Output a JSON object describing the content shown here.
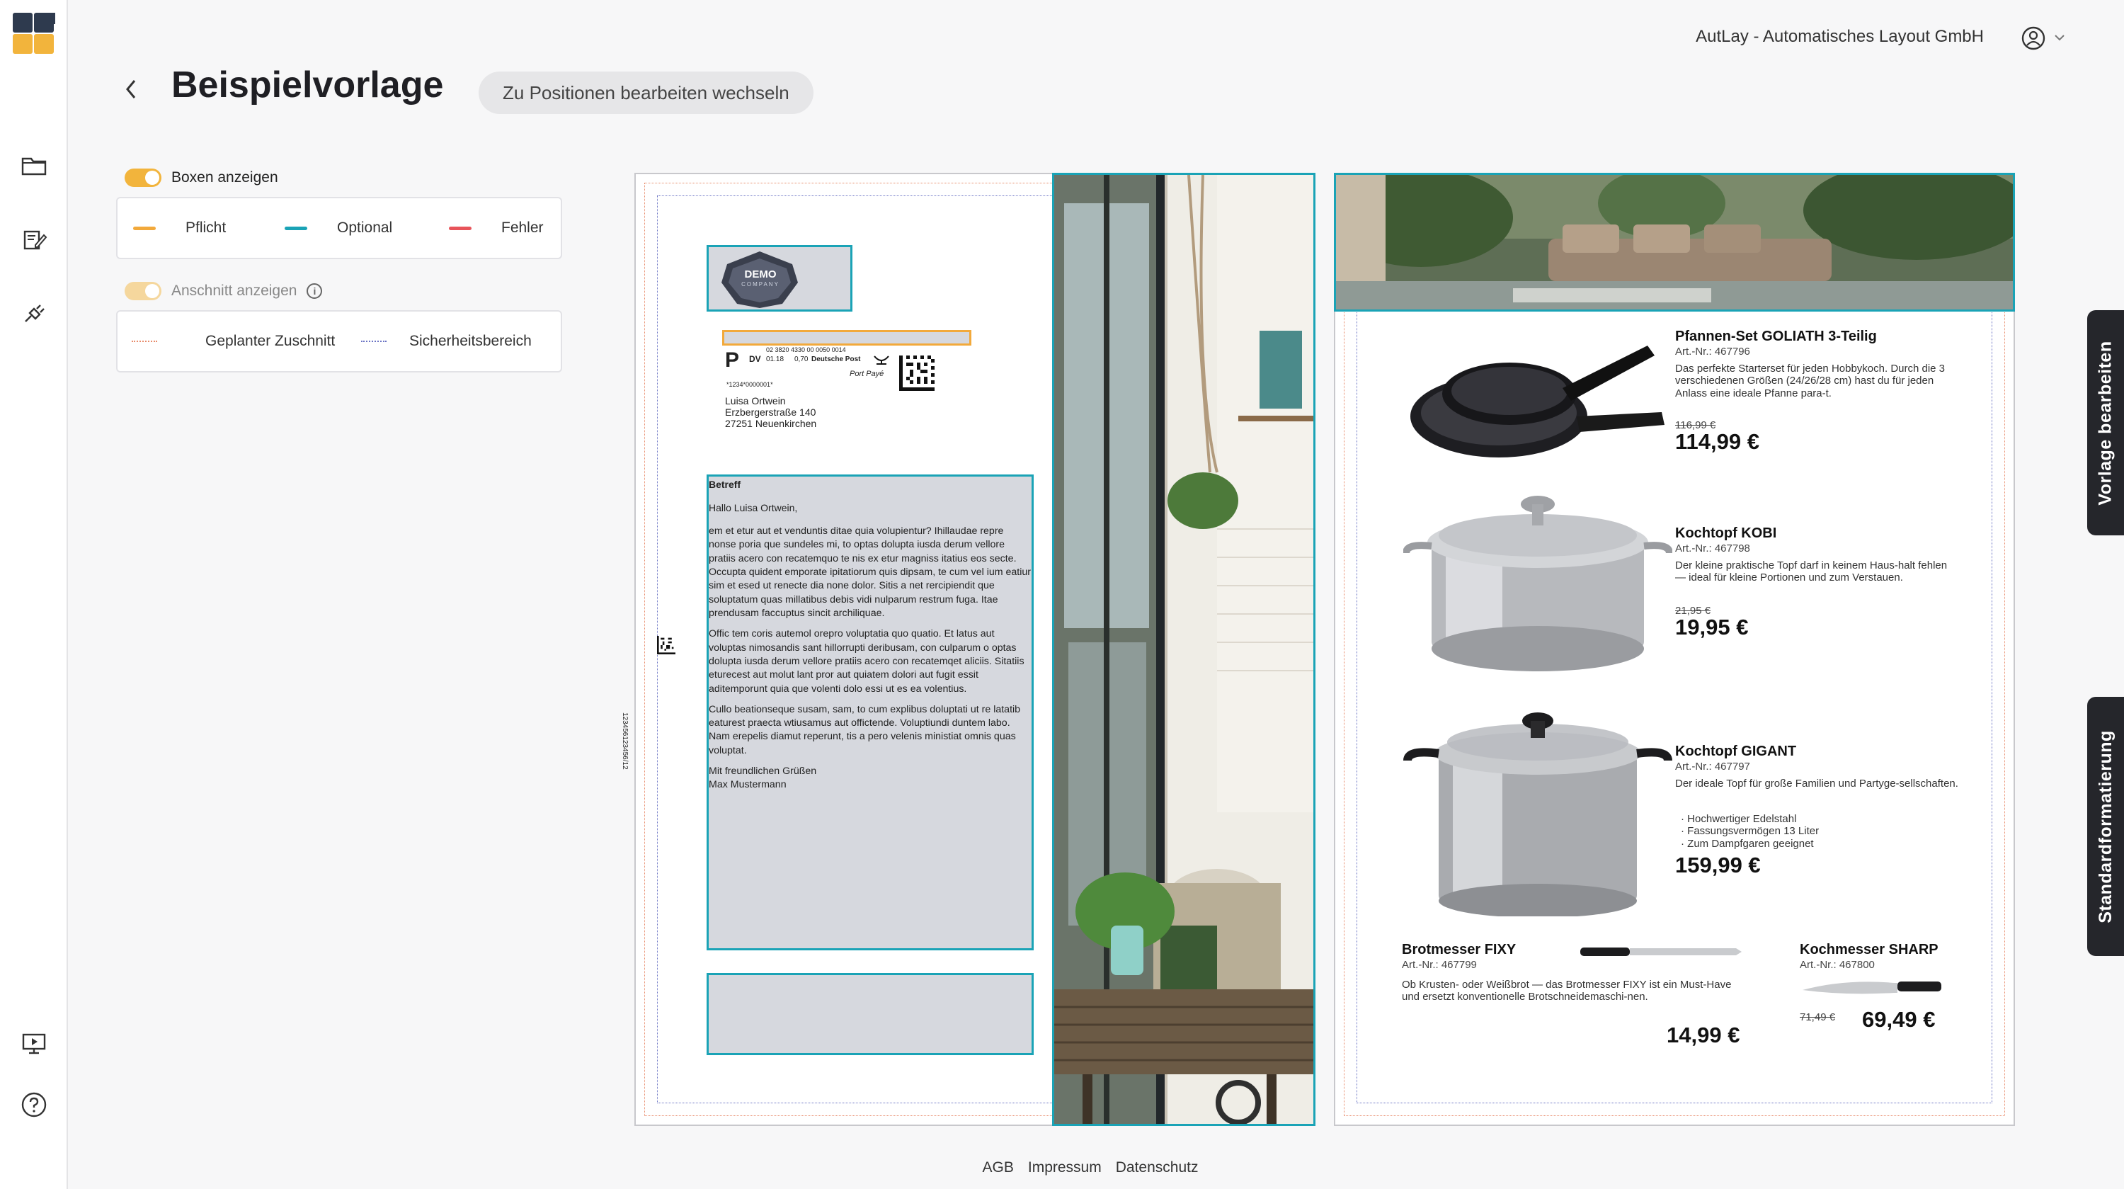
{
  "app": {
    "company": "AutLay - Automatisches Layout GmbH"
  },
  "header": {
    "title": "Beispielvorlage",
    "switch_label": "Zu Positionen bearbeiten wechseln"
  },
  "options": {
    "boxes_toggle_label": "Boxen anzeigen",
    "boxes_toggle_on": true,
    "legend": [
      {
        "label": "Pflicht",
        "color": "#f2a93b"
      },
      {
        "label": "Optional",
        "color": "#1aa3b6"
      },
      {
        "label": "Fehler",
        "color": "#e8545a"
      }
    ],
    "bleed_toggle_label": "Anschnitt anzeigen",
    "bleed_toggle_on": true,
    "bleed_legend": [
      {
        "label": "Geplanter Zuschnitt",
        "color": "#e88c6c"
      },
      {
        "label": "Sicherheitsbereich",
        "color": "#6b74c4"
      }
    ]
  },
  "letter": {
    "logo_text": "DEMO",
    "logo_sub": "COMPANY",
    "postage_code": "02 3820 4330 00 0050 0014",
    "postage_dv": "DV",
    "postage_date": "01.18",
    "postage_amount": "0,70",
    "postage_carrier": "Deutsche Post",
    "port_paye": "Port Payé",
    "postage_letter": "P",
    "ref_number": "*1234*0000001*",
    "recipient": [
      "Luisa Ortwein",
      "Erzbergerstraße 140",
      "27251 Neuenkirchen"
    ],
    "side_code": "123456123456/12",
    "subject": "Betreff",
    "greeting": "Hallo Luisa Ortwein,",
    "paragraphs": [
      "em et etur aut et venduntis ditae quia volupientur? Ihillaudae repre nonse poria que sundeles mi, to optas dolupta iusda derum vellore pratiis acero con recatemquo te nis ex etur magniss itatius eos secte. Occupta quident emporate ipitatiorum quis dipsam, te cum vel ium eatiur sim et esed ut renecte dia none dolor. Sitis a net rercipiendit que soluptatum quas millatibus debis vidi nulparum restrum fuga. Itae prendusam faccuptus sincit archiliquae.",
      "Offic tem coris autemol orepro voluptatia quo quatio. Et latus aut voluptas nimosandis sant hillorrupti deribusam, con culparum o optas dolupta iusda derum vellore pratiis acero con recatemqet aliciis. Sitatiis eturecest aut molut lant pror aut quiatem dolori aut fugit essit aditemporunt quia que volenti dolo essi ut es ea volentius.",
      "Cullo beationseque susam, sam, to cum explibus doluptati ut re latatib eaturest praecta wtiusamus aut offictende. Voluptiundi duntem labo. Nam erepelis diamut reperunt, tis a pero velenis ministiat omnis quas voluptat."
    ],
    "closing": [
      "Mit freundlichen Grüßen",
      "Max Mustermann"
    ]
  },
  "products": [
    {
      "name": "Pfannen-Set GOLIATH 3-Teilig",
      "art": "Art.-Nr.: 467796",
      "desc": "Das perfekte Starterset für jeden Hobbykoch. Durch die 3 verschiedenen Größen (24/26/28 cm) hast du für jeden Anlass eine ideale Pfanne para-t.",
      "old_price": "116,99 €",
      "price": "114,99 €"
    },
    {
      "name": "Kochtopf KOBI",
      "art": "Art.-Nr.: 467798",
      "desc": "Der kleine praktische Topf darf in keinem Haus-halt fehlen — ideal für kleine Portionen und zum Verstauen.",
      "old_price": "21,95 €",
      "price": "19,95 €"
    },
    {
      "name": "Kochtopf GIGANT",
      "art": "Art.-Nr.: 467797",
      "desc": "Der ideale Topf für große Familien und Partyge-sellschaften.",
      "bullets": [
        "Hochwertiger Edelstahl",
        "Fassungsvermögen 13 Liter",
        "Zum Dampfgaren geeignet"
      ],
      "price": "159,99 €"
    },
    {
      "name": "Brotmesser FIXY",
      "art": "Art.-Nr.: 467799",
      "desc": "Ob Krusten- oder Weißbrot — das Brotmesser FIXY ist ein Must-Have und ersetzt konventionelle Brotschneidemaschi-nen.",
      "price": "14,99 €"
    },
    {
      "name": "Kochmesser SHARP",
      "art": "Art.-Nr.: 467800",
      "old_price": "71,49 €",
      "price": "69,49 €"
    }
  ],
  "side_tabs": {
    "edit_template": "Vorlage bearbeiten",
    "default_format": "Standardformatierung"
  },
  "footer": {
    "links": [
      "AGB",
      "Impressum",
      "Datenschutz"
    ]
  },
  "icons": {
    "sidebar": [
      "folder-icon",
      "edit-document-icon",
      "plug-icon",
      "presentation-icon",
      "help-icon"
    ]
  },
  "colors": {
    "accent": "#f2b43c",
    "optional": "#1aa3b6",
    "error": "#e8545a",
    "dark": "#25262b"
  }
}
